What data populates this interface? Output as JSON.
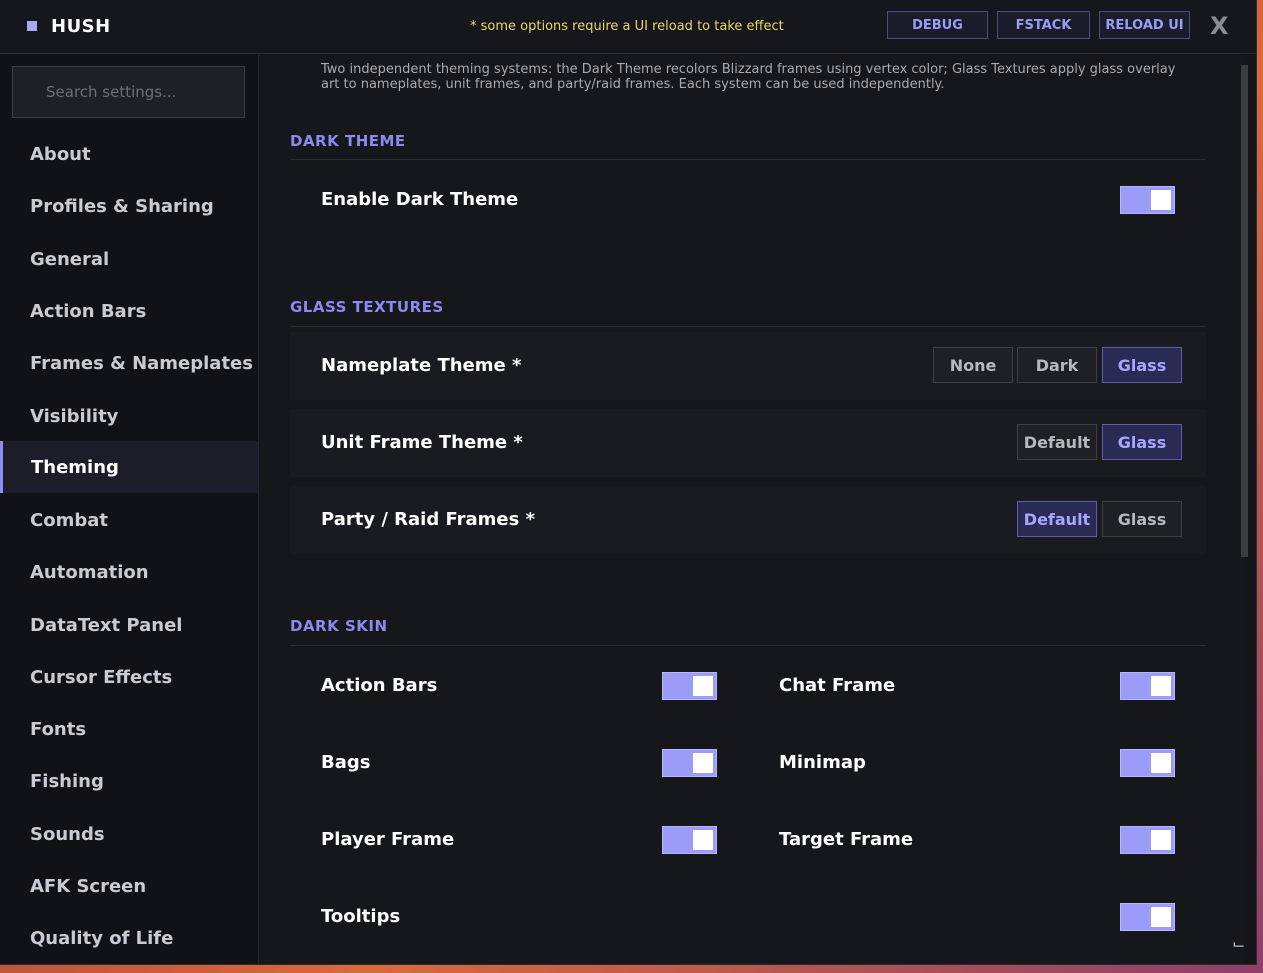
{
  "app": {
    "title": "HUSH",
    "reload_note": "* some options require a UI reload to take effect"
  },
  "toolbar": {
    "debug": "DEBUG",
    "fstack": "FSTACK",
    "reload": "RELOAD UI",
    "close": "X"
  },
  "search": {
    "placeholder": "Search settings..."
  },
  "sidebar": {
    "items": [
      {
        "label": "About"
      },
      {
        "label": "Profiles & Sharing"
      },
      {
        "label": "General"
      },
      {
        "label": "Action Bars"
      },
      {
        "label": "Frames & Nameplates"
      },
      {
        "label": "Visibility"
      },
      {
        "label": "Theming"
      },
      {
        "label": "Combat"
      },
      {
        "label": "Automation"
      },
      {
        "label": "DataText Panel"
      },
      {
        "label": "Cursor Effects"
      },
      {
        "label": "Fonts"
      },
      {
        "label": "Fishing"
      },
      {
        "label": "Sounds"
      },
      {
        "label": "AFK Screen"
      },
      {
        "label": "Quality of Life"
      }
    ],
    "active": "Theming"
  },
  "content": {
    "intro": "Two independent theming systems: the Dark Theme recolors Blizzard frames using vertex color; Glass Textures apply glass overlay art to nameplates, unit frames, and party/raid frames. Each system can be used independently.",
    "dark_theme": {
      "title": "DARK THEME",
      "enable": {
        "label": "Enable Dark Theme",
        "on": true
      }
    },
    "glass": {
      "title": "GLASS TEXTURES",
      "nameplate": {
        "label": "Nameplate Theme *",
        "options": [
          "None",
          "Dark",
          "Glass"
        ],
        "selected": "Glass"
      },
      "unitframe": {
        "label": "Unit Frame Theme *",
        "options": [
          "Default",
          "Glass"
        ],
        "selected": "Glass"
      },
      "party": {
        "label": "Party / Raid Frames *",
        "options": [
          "Default",
          "Glass"
        ],
        "selected": "Default"
      }
    },
    "dark_skin": {
      "title": "DARK SKIN",
      "items": [
        {
          "label": "Action Bars",
          "on": true
        },
        {
          "label": "Chat Frame",
          "on": true
        },
        {
          "label": "Bags",
          "on": true
        },
        {
          "label": "Minimap",
          "on": true
        },
        {
          "label": "Player Frame",
          "on": true
        },
        {
          "label": "Target Frame",
          "on": true
        },
        {
          "label": "Tooltips",
          "on": true
        }
      ]
    }
  },
  "colors": {
    "accent": "#9b9cf7",
    "note": "#e7d76a",
    "section": "#8b8af0",
    "bg": "#141519"
  }
}
